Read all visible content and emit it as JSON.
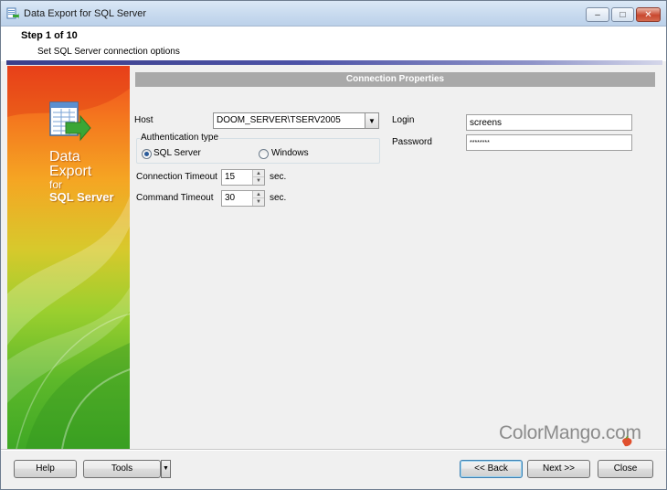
{
  "window": {
    "title": "Data Export for SQL Server",
    "min_glyph": "–",
    "max_glyph": "□",
    "close_glyph": "✕"
  },
  "header": {
    "step": "Step 1 of 10",
    "description": "Set SQL Server connection options"
  },
  "banner": {
    "line1": "Data",
    "line2": "Export",
    "line3": "for",
    "line4": "SQL Server"
  },
  "section": {
    "title": "Connection Properties"
  },
  "form": {
    "host_label": "Host",
    "host_value": "DOOM_SERVER\\TSERV2005",
    "auth_group_title": "Authentication type",
    "auth_sql_label": "SQL Server",
    "auth_windows_label": "Windows",
    "auth_selected": "SQL Server",
    "connection_timeout_label": "Connection Timeout",
    "connection_timeout_value": "15",
    "command_timeout_label": "Command Timeout",
    "command_timeout_value": "30",
    "sec_unit": "sec.",
    "login_label": "Login",
    "login_value": "screens",
    "password_label": "Password",
    "password_value": "********"
  },
  "watermark": {
    "text": "ColorMango.com"
  },
  "footer": {
    "help": "Help",
    "tools": "Tools",
    "back": "<< Back",
    "next": "Next >>",
    "close": "Close"
  },
  "colors": {
    "section_header": "#a9a9a9",
    "header_stripe": "#3b3f8a",
    "banner_top": "#f04a1e",
    "banner_bottom": "#3fa825"
  }
}
